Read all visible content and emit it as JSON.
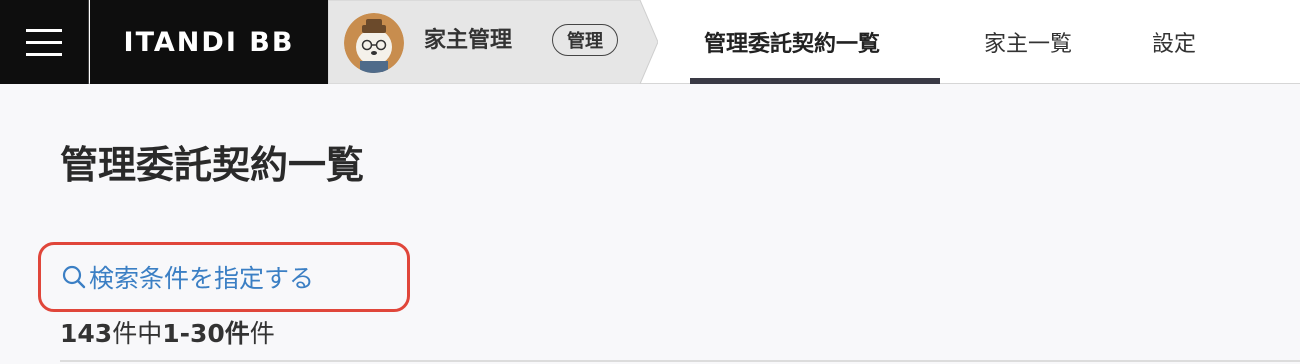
{
  "header": {
    "logo": "ITANDI BB",
    "product_name": "家主管理",
    "product_badge": "管理",
    "nav": [
      {
        "label": "管理委託契約一覧",
        "active": true
      },
      {
        "label": "家主一覧",
        "active": false
      },
      {
        "label": "設定",
        "active": false
      }
    ]
  },
  "main": {
    "title": "管理委託契約一覧",
    "search_link": "検索条件を指定する",
    "count": {
      "total": "143",
      "total_suffix": "件中",
      "range": "1-30",
      "range_suffix": "件",
      "trailing": "件"
    }
  },
  "colors": {
    "link": "#3b7fc4",
    "highlight": "#e0463a",
    "topbar_dark": "#0e0e0e"
  },
  "icons": {
    "menu": "hamburger-icon",
    "search": "search-icon",
    "avatar": "bear-avatar"
  }
}
